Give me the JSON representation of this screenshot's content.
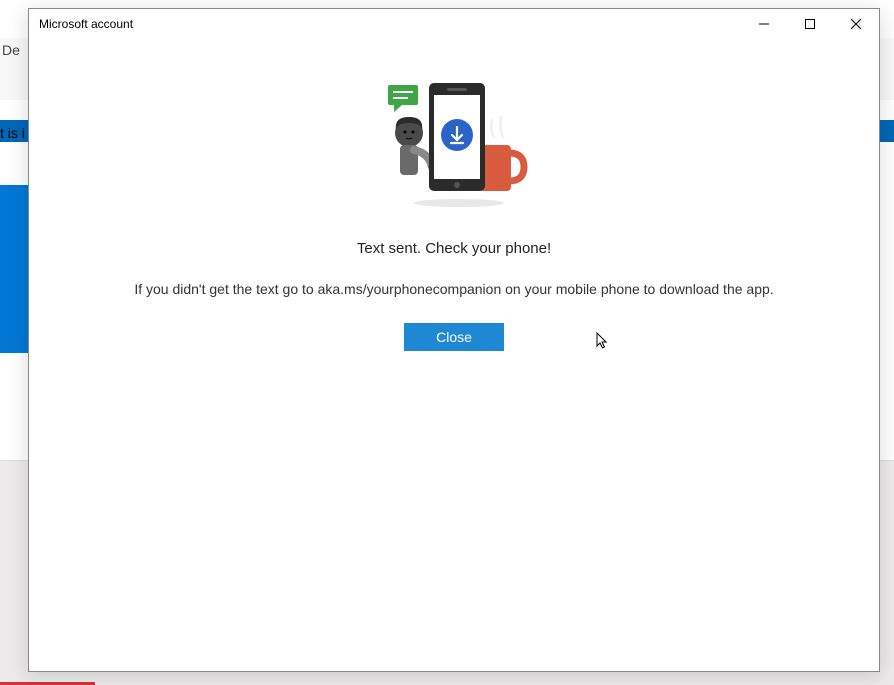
{
  "background": {
    "partial_text_left": "De",
    "partial_text_is": "t is i"
  },
  "dialog": {
    "title": "Microsoft account",
    "primary_message": "Text sent. Check your phone!",
    "secondary_message": "If you didn't get the text go to aka.ms/yourphonecompanion on your mobile phone to download the app.",
    "close_button_label": "Close"
  }
}
